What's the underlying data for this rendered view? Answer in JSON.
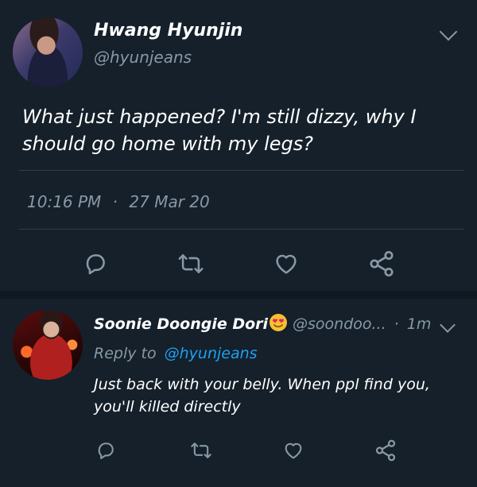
{
  "tweet": {
    "author_name": "Hwang Hyunjin",
    "author_handle": "@hyunjeans",
    "text": "What just happened? I'm still dizzy, why I should go home with my legs?",
    "time": "10:16 PM",
    "separator": "·",
    "date": "27 Mar 20"
  },
  "reply": {
    "author_name": "Soonie Doongie Dori",
    "author_handle": "@soondoo...",
    "time_sep": "·",
    "time": "1m",
    "reply_prefix": "Reply to",
    "reply_mention": "@hyunjeans",
    "text": "Just back with your belly. When ppl find you, you'll killed directly"
  },
  "icons": {
    "reply": "reply-icon",
    "retweet": "retweet-icon",
    "like": "heart-icon",
    "share": "share-icon",
    "more": "chevron-down-icon",
    "emoji": "heart-eyes-emoji"
  },
  "colors": {
    "background": "#15202b",
    "secondary_text": "#8899a6",
    "link": "#1da1f2",
    "divider": "#2f3d4a"
  }
}
